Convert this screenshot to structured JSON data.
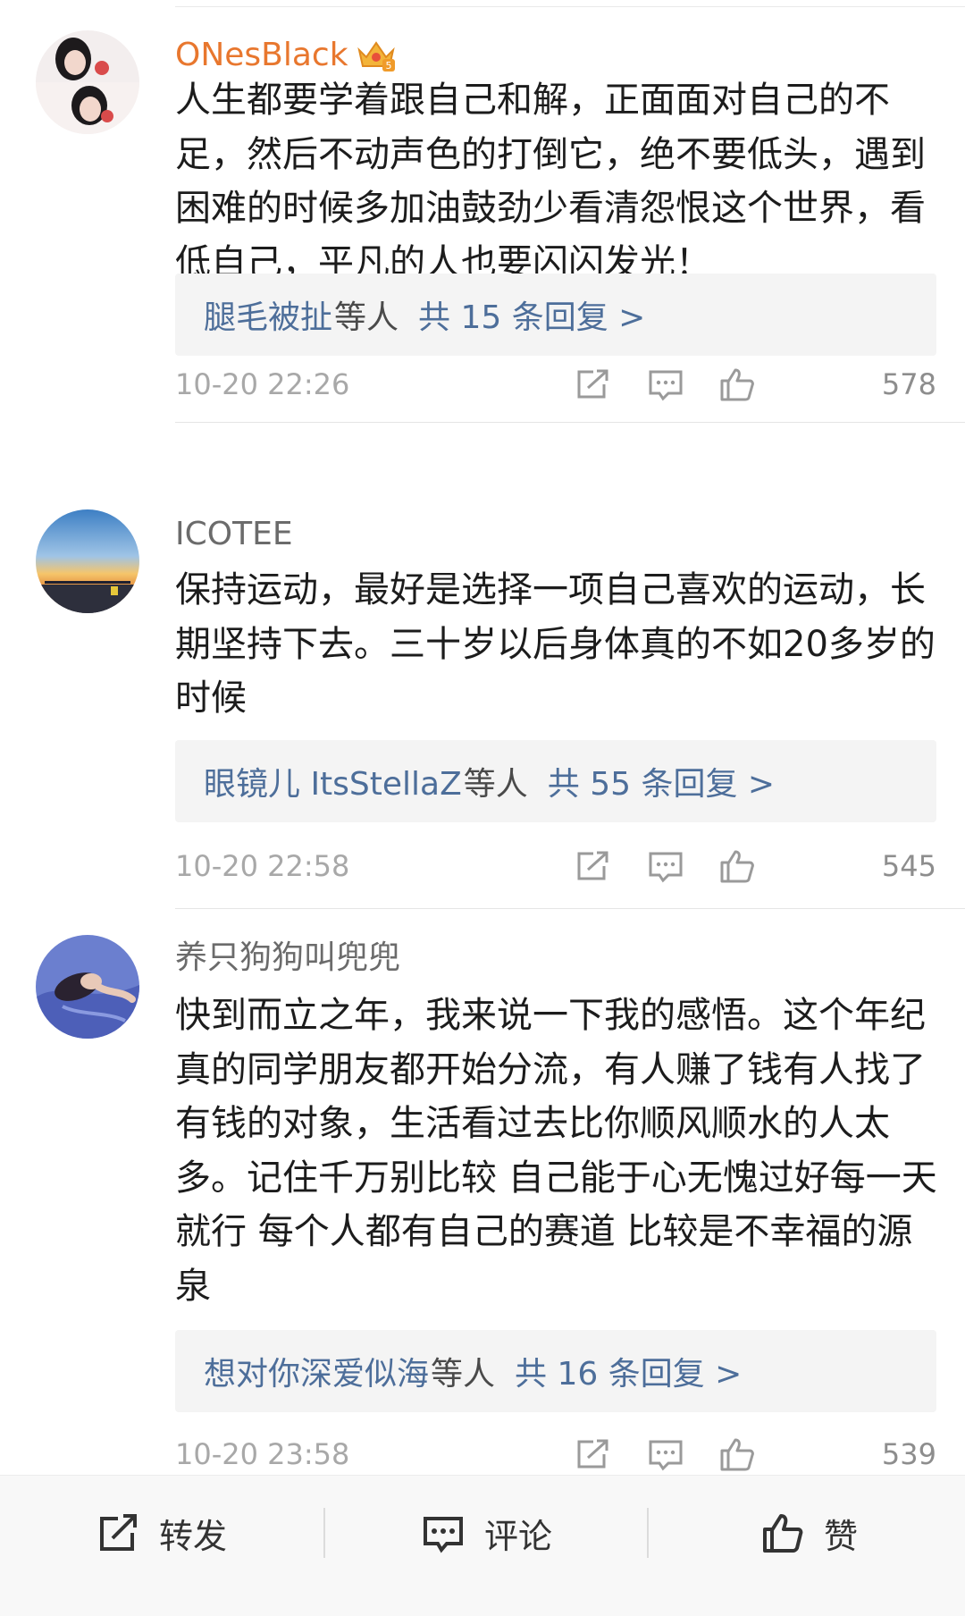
{
  "comments": [
    {
      "username": "ONesBlack",
      "text": "人生都要学着跟自己和解，正面面对自己的不足，然后不动声色的打倒它，绝不要低头，遇到困难的时候多加油鼓劲少看清怨恨这个世界，看低自己，平凡的人也要闪闪发光！",
      "reply_names": "腿毛被扯",
      "reply_mid": "等人",
      "reply_total": "共 15 条回复 >",
      "time": "10-20 22:26",
      "likes": "578"
    },
    {
      "username": "ICOTEE",
      "text": "保持运动，最好是选择一项自己喜欢的运动，长期坚持下去。三十岁以后身体真的不如20多岁的时候",
      "reply_names": "眼镜儿 ItsStellaZ",
      "reply_mid": "等人",
      "reply_total": "共 55 条回复 >",
      "time": "10-20 22:58",
      "likes": "545"
    },
    {
      "username": "养只狗狗叫兜兜",
      "text": "快到而立之年，我来说一下我的感悟。这个年纪真的同学朋友都开始分流，有人赚了钱有人找了有钱的对象，生活看过去比你顺风顺水的人太多。记住千万别比较 自己能于心无愧过好每一天就行  每个人都有自己的赛道  比较是不幸福的源泉",
      "reply_names": "想对你深爱似海",
      "reply_mid": "等人",
      "reply_total": "共 16 条回复 >",
      "time": "10-20 23:58",
      "likes": "539"
    }
  ],
  "bottom_bar": {
    "repost_label": "转发",
    "comment_label": "评论",
    "like_label": "赞"
  },
  "icons": {
    "vip_badge": "crown-badge-icon",
    "share": "share-icon",
    "comment": "comment-icon",
    "like": "thumbs-up-icon"
  },
  "colors": {
    "vip_name": "#e8772e",
    "reply_link": "#4d6e9a",
    "meta_gray": "#a8a8a8"
  }
}
